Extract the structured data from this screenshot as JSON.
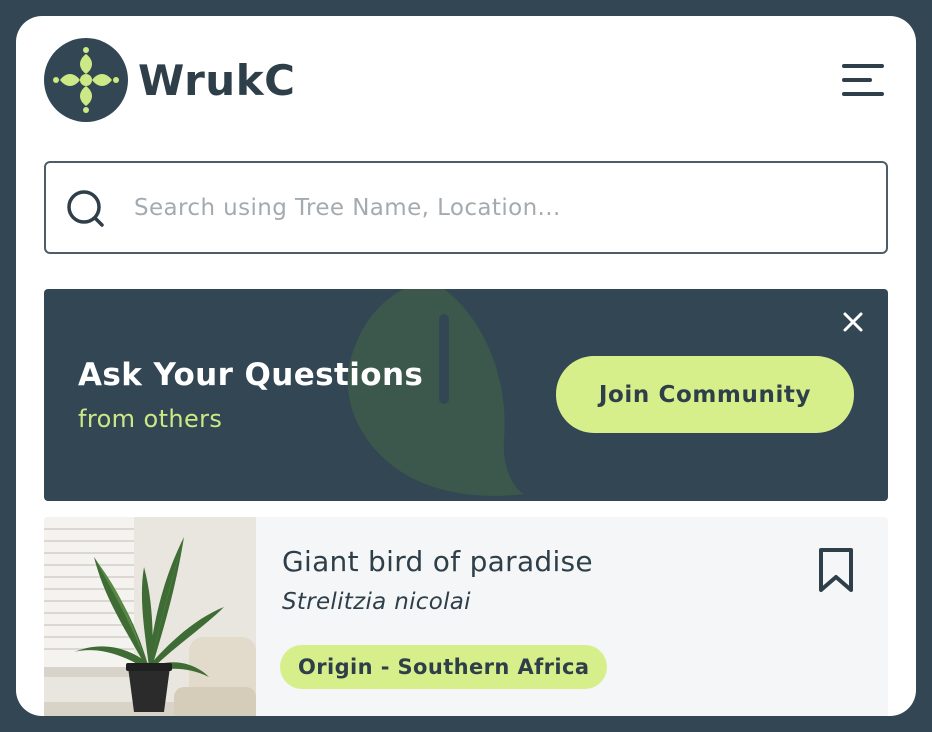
{
  "app": {
    "brand": "WrukC"
  },
  "header": {
    "menu_icon": "hamburger-menu-icon"
  },
  "search": {
    "placeholder": "Search using Tree Name, Location...",
    "value": "",
    "icon": "search-icon"
  },
  "banner": {
    "title": "Ask Your Questions",
    "subtitle": "from others",
    "cta_label": "Join Community",
    "close_icon": "close-icon"
  },
  "tree_card": {
    "common_name": "Giant bird of paradise",
    "scientific_name": "Strelitzia nicolai",
    "origin_badge": "Origin - Southern Africa",
    "bookmark_icon": "bookmark-icon",
    "image": "plant-photo"
  },
  "colors": {
    "frame": "#334653",
    "brand_dark": "#2f3f4a",
    "accent": "#d7ef8b",
    "accent_text": "#cde985",
    "card_bg": "#f4f6f7"
  }
}
